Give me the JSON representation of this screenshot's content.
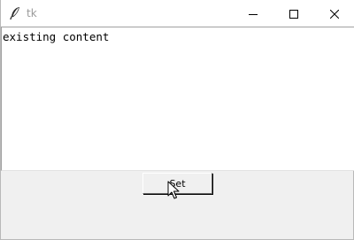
{
  "window": {
    "title": "tk",
    "app_icon": "feather-icon",
    "controls": {
      "minimize_icon": "minimize-icon",
      "maximize_icon": "maximize-icon",
      "close_icon": "close-icon"
    }
  },
  "text_widget": {
    "content": "existing content"
  },
  "set_button": {
    "label": "Set"
  },
  "cursor": {
    "icon": "mouse-pointer-icon"
  },
  "colors": {
    "window_background": "#f0f0f0",
    "titlebar_background": "#ffffff",
    "title_text": "#9a9a9a",
    "text_background": "#ffffff"
  }
}
